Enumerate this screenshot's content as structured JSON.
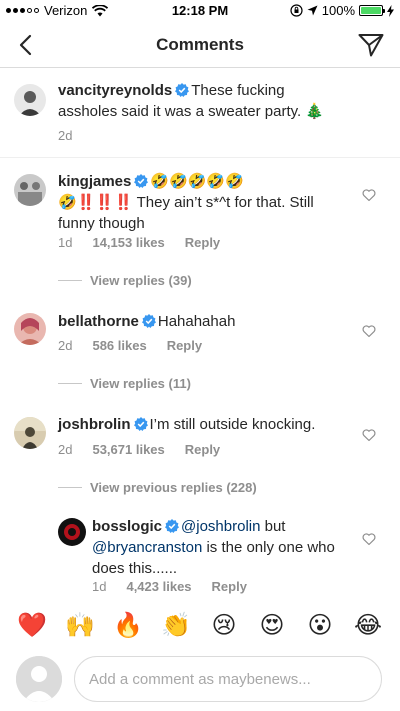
{
  "status_bar": {
    "carrier": "Verizon",
    "time": "12:18 PM",
    "battery": "100%",
    "battery_level": 1.0,
    "icons": [
      "signal-icon",
      "wifi-icon",
      "lock-rotation-icon",
      "location-icon",
      "battery-icon",
      "charging-icon"
    ]
  },
  "nav": {
    "title": "Comments",
    "back_icon": "back-chevron-icon",
    "dm_icon": "direct-message-icon"
  },
  "caption": {
    "username": "vancityreynolds",
    "text": "These fucking assholes said it was a sweater party. 🎄",
    "text_line1": "These fucking",
    "text_line2": "assholes said it was a sweater party. 🎄",
    "time": "2d"
  },
  "comments": [
    {
      "username": "kingjames",
      "text_line1": "🤣🤣🤣🤣🤣",
      "text_line2": "🤣‼️‼️‼️ They ain’t s*^t for that. Still",
      "text_line3": "funny though",
      "time": "1d",
      "likes": "14,153 likes",
      "reply": "Reply",
      "view_replies": "View replies (39)"
    },
    {
      "username": "bellathorne",
      "text_line1": "Hahahahah",
      "time": "2d",
      "likes": "586 likes",
      "reply": "Reply",
      "view_replies": "View replies (11)"
    },
    {
      "username": "joshbrolin",
      "text_line1": "I’m still outside knocking.",
      "time": "2d",
      "likes": "53,671 likes",
      "reply": "Reply",
      "view_replies": "View previous replies (228)"
    }
  ],
  "reply": {
    "username": "bosslogic",
    "mention1": "@joshbrolin",
    "text_a": " but",
    "mention2": "@bryancranston",
    "text_b": " is the only one who",
    "text_c": "does this......",
    "time": "1d",
    "likes": "4,423 likes",
    "reply": "Reply"
  },
  "emoji_bar": [
    {
      "name": "red-heart",
      "glyph": "❤️"
    },
    {
      "name": "raising-hands",
      "glyph": "🙌"
    },
    {
      "name": "fire",
      "glyph": "🔥"
    },
    {
      "name": "clapping-hands",
      "glyph": "👏"
    },
    {
      "name": "crying-face",
      "glyph": "😢"
    },
    {
      "name": "heart-eyes",
      "glyph": "😍"
    },
    {
      "name": "surprised-face",
      "glyph": "😮"
    },
    {
      "name": "tears-of-joy",
      "glyph": "😂"
    }
  ],
  "input": {
    "placeholder": "Add a comment as maybenews..."
  },
  "colors": {
    "verified": "#3897f0",
    "mention": "#003569",
    "secondary_text": "#8e8e8e",
    "battery": "#4cd964"
  }
}
